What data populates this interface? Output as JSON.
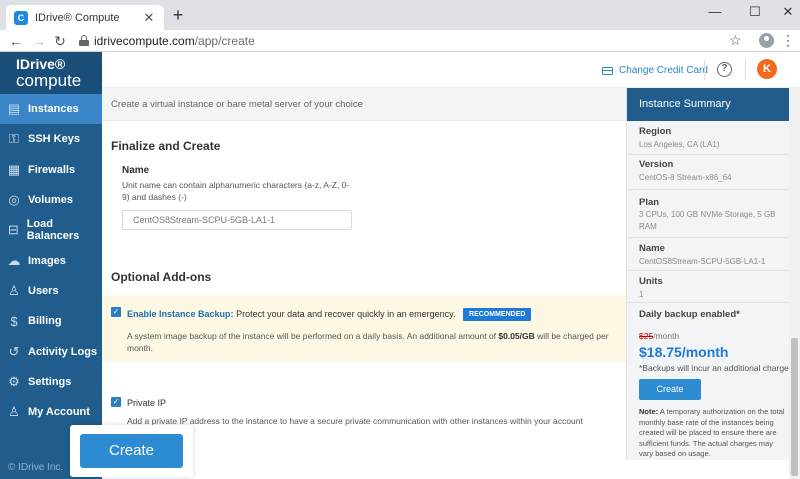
{
  "browser": {
    "tab_title": "IDrive® Compute",
    "tab_favicon": "C",
    "url_host": "idrivecompute.com",
    "url_path": "/app/create"
  },
  "sidebar": {
    "logo_top": "IDrive®",
    "logo_bottom": "compute",
    "items": [
      {
        "label": "Instances",
        "icon": "server-icon"
      },
      {
        "label": "SSH Keys",
        "icon": "key-icon"
      },
      {
        "label": "Firewalls",
        "icon": "firewall-icon"
      },
      {
        "label": "Volumes",
        "icon": "volume-icon"
      },
      {
        "label": "Load Balancers",
        "icon": "load-balancer-icon"
      },
      {
        "label": "Images",
        "icon": "cloud-upload-icon"
      },
      {
        "label": "Users",
        "icon": "user-icon"
      },
      {
        "label": "Billing",
        "icon": "billing-icon"
      },
      {
        "label": "Activity Logs",
        "icon": "history-icon"
      },
      {
        "label": "Settings",
        "icon": "gear-icon"
      },
      {
        "label": "My Account",
        "icon": "account-icon"
      }
    ],
    "copyright": "© IDrive Inc."
  },
  "header": {
    "change_credit_card": "Change Credit Card",
    "help": "?",
    "avatar_initial": "K"
  },
  "main": {
    "subtitle": "Create a virtual instance or bare metal server of your choice",
    "finalize_title": "Finalize and Create",
    "name_label": "Name",
    "name_hint_line1": "Unit name can contain alphanumeric characters (a-z, A-Z, 0-",
    "name_hint_line2": "9) and dashes (-)",
    "name_value": "CentOS8Stream-SCPU-5GB-LA1-1",
    "addons_title": "Optional Add-ons",
    "backup_title": "Enable Instance Backup:",
    "backup_text": "Protect your data and recover quickly in an emergency.",
    "backup_badge": "RECOMMENDED",
    "backup_desc_1": "A system image backup of the instance will be performed on a daily basis. An additional amount of",
    "backup_desc_amount": "$0.05/GB",
    "backup_desc_2": "will be charged",
    "backup_desc_3": "per month.",
    "private_ip_label": "Private IP",
    "private_ip_desc": "Add a private IP address to the instance to have a secure private communication with other instances within your account",
    "create_button": "Create"
  },
  "summary": {
    "title": "Instance Summary",
    "region_label": "Region",
    "region_value": "Los Angeles, CA (LA1)",
    "version_label": "Version",
    "version_value": "CentOS-8 Stream-x86_64",
    "plan_label": "Plan",
    "plan_value": "3 CPUs, 100 GB NVMe Storage, 5 GB RAM",
    "name_label": "Name",
    "name_value": "CentOS8Stream-SCPU-5GB-LA1-1",
    "units_label": "Units",
    "units_value": "1",
    "backup_label": "Daily backup enabled*",
    "old_price": "$25",
    "old_price_suffix": "/month",
    "new_price": "$18.75/month",
    "backup_note": "*Backups will incur an additional charge",
    "create_button": "Create",
    "note_label": "Note:",
    "note_text": "A temporary authorization on the total monthly base rate of the instances being created will be placed to ensure there are sufficient funds. The actual charges may vary based on usage."
  }
}
